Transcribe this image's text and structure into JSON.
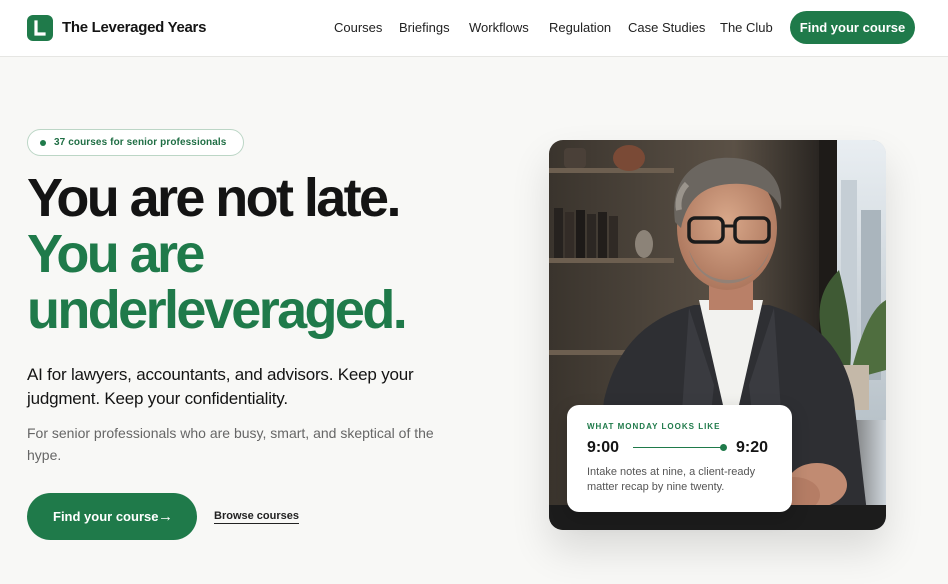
{
  "nav": {
    "brand": "The Leveraged Years",
    "logo_letter": "L",
    "links": [
      "Courses",
      "Briefings",
      "Workflows",
      "Regulation",
      "Case Studies",
      "The Club"
    ],
    "cta": "Find your course"
  },
  "hero": {
    "pill": "37 courses for senior professionals",
    "headline_1": "You are not late.",
    "headline_2": "You are",
    "headline_3": "underleveraged.",
    "lede": "AI for lawyers, accountants, and advisors. Keep your judgment. Keep your confidentiality.",
    "sub": "For senior professionals who are busy, smart, and skeptical of the hype.",
    "cta_primary": "Find your course",
    "cta_arrow": "→",
    "cta_secondary": "Browse courses"
  },
  "card": {
    "label": "WHAT MONDAY LOOKS LIKE",
    "time_start": "9:00",
    "time_end": "9:20",
    "text": "Intake notes at nine, a client-ready matter recap by nine twenty."
  },
  "colors": {
    "accent": "#1f7a4a",
    "background": "#f8f8f6"
  },
  "icons": {
    "logo": "logo-mark",
    "pill": "status-dot",
    "cta": "arrow-right-icon"
  }
}
